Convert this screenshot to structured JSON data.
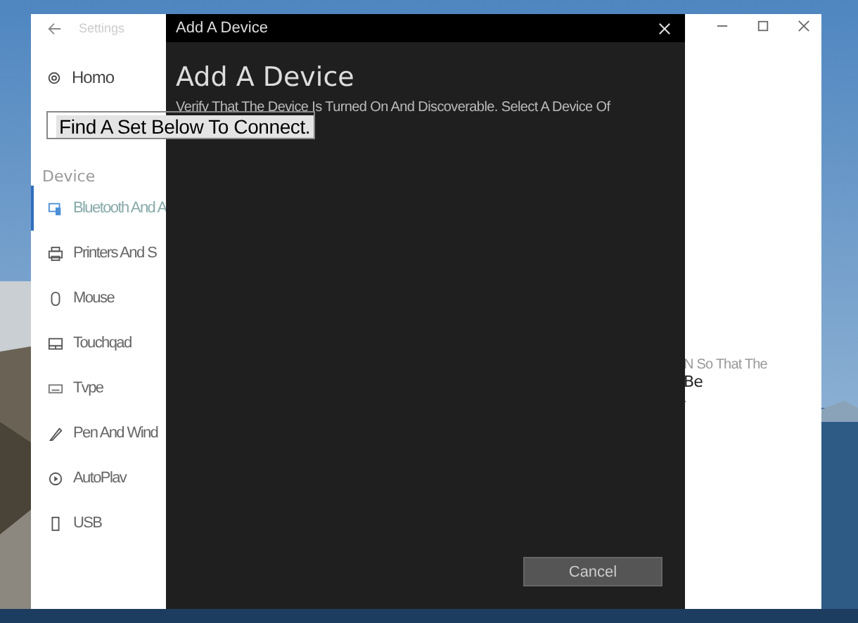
{
  "settings_window": {
    "title": "Settings",
    "home": "Homo",
    "search": {
      "value": "Find A Set Below To Connect."
    },
    "section": "Device",
    "items": [
      {
        "label": "Bluetooth And A",
        "kind": "bluetooth",
        "selected": true
      },
      {
        "label": "Printers And S",
        "kind": "printer",
        "selected": false
      },
      {
        "label": "Mouse",
        "kind": "mouse",
        "selected": false
      },
      {
        "label": "Touchqad",
        "kind": "touchpad",
        "selected": false
      },
      {
        "label": "Tvpe",
        "kind": "keyboard",
        "selected": false
      },
      {
        "label": "Pen And Wind",
        "kind": "pen",
        "selected": false
      },
      {
        "label": "AutoPlav",
        "kind": "autoplay",
        "selected": false
      },
      {
        "label": "USB",
        "kind": "usb",
        "selected": false
      }
    ],
    "content_fragments": [
      "N So That The",
      "Be",
      "."
    ]
  },
  "dialog": {
    "title": "Add A Device",
    "heading": "Add A Device",
    "description": "Verifv That The Device Is Turned On And Discoverable. Select A Device Of",
    "buttons": [
      "Cancel"
    ]
  }
}
